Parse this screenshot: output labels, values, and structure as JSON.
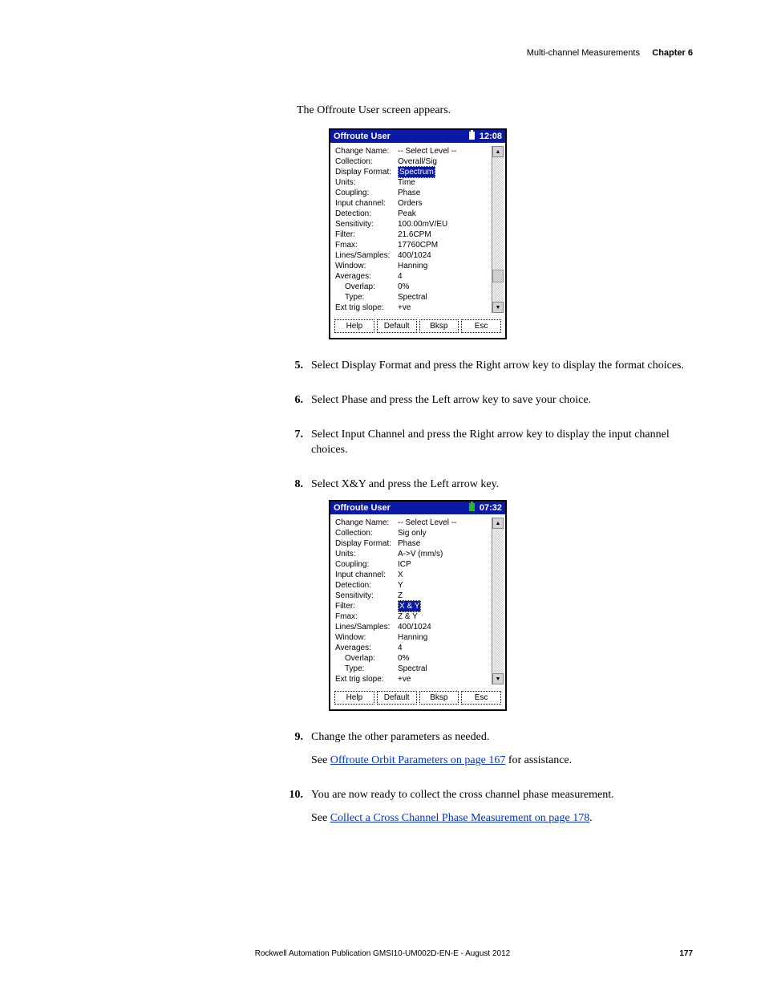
{
  "header": {
    "section": "Multi-channel Measurements",
    "chapter_label": "Chapter 6"
  },
  "intro": "The Offroute User screen appears.",
  "device1": {
    "title": "Offroute User",
    "time": "12:08",
    "labels": {
      "change_name": "Change Name:",
      "collection": "Collection:",
      "display_format": "Display Format:",
      "units": "Units:",
      "coupling": "Coupling:",
      "input_channel": "Input channel:",
      "detection": "Detection:",
      "sensitivity": "Sensitivity:",
      "filter": "Filter:",
      "fmax": "Fmax:",
      "lines_samples": "Lines/Samples:",
      "window": "Window:",
      "averages": "Averages:",
      "overlap": "Overlap:",
      "type": "Type:",
      "ext_trig_slope": "Ext trig slope:"
    },
    "values": {
      "change_name": "-- Select Level --",
      "collection": "Overall/Sig",
      "display_format_sel": "Spectrum",
      "opt_time": "Time",
      "opt_phase": "Phase",
      "opt_orders": "Orders",
      "detection": "Peak",
      "sensitivity": "100.00mV/EU",
      "filter": "21.6CPM",
      "fmax": "17760CPM",
      "lines_samples": "400/1024",
      "window": "Hanning",
      "averages": "4",
      "overlap": "0%",
      "type": "Spectral",
      "ext_trig_slope": "+ve"
    },
    "buttons": {
      "help": "Help",
      "default": "Default",
      "bksp": "Bksp",
      "esc": "Esc"
    }
  },
  "steps": {
    "s5": "Select Display Format and press the Right arrow key to display the format choices.",
    "s6": "Select Phase and press the Left arrow key to save your choice.",
    "s7": "Select Input Channel and press the Right arrow key to display the input channel choices.",
    "s8": "Select X&Y and press the Left arrow key.",
    "s9": "Change the other parameters as needed.",
    "s9b_pre": "See ",
    "s9b_link": "Offroute Orbit Parameters on page 167",
    "s9b_post": " for assistance.",
    "s10": "You are now ready to collect the cross channel phase measurement.",
    "s10b_pre": "See ",
    "s10b_link": "Collect a Cross Channel Phase Measurement on page 178",
    "s10b_post": "."
  },
  "device2": {
    "title": "Offroute User",
    "time": "07:32",
    "labels": {
      "change_name": "Change Name:",
      "collection": "Collection:",
      "display_format": "Display Format:",
      "units": "Units:",
      "coupling": "Coupling:",
      "input_channel": "Input channel:",
      "detection": "Detection:",
      "sensitivity": "Sensitivity:",
      "filter": "Filter:",
      "fmax": "Fmax:",
      "lines_samples": "Lines/Samples:",
      "window": "Window:",
      "averages": "Averages:",
      "overlap": "Overlap:",
      "type": "Type:",
      "ext_trig_slope": "Ext trig slope:"
    },
    "values": {
      "change_name": "-- Select Level --",
      "collection": "Sig only",
      "display_format": "Phase",
      "units": "A->V (mm/s)",
      "coupling": "ICP",
      "opt_x": "X",
      "opt_y": "Y",
      "opt_z": "Z",
      "input_sel": "X & Y",
      "opt_zy": "Z & Y",
      "lines_samples": "400/1024",
      "window": "Hanning",
      "averages": "4",
      "overlap": "0%",
      "type": "Spectral",
      "ext_trig_slope": "+ve"
    },
    "buttons": {
      "help": "Help",
      "default": "Default",
      "bksp": "Bksp",
      "esc": "Esc"
    }
  },
  "footer": {
    "publication": "Rockwell Automation Publication GMSI10-UM002D-EN-E - August 2012",
    "page": "177"
  }
}
